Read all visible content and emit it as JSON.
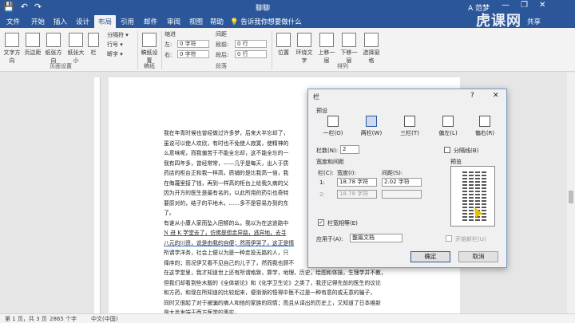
{
  "titlebar": {
    "doc_title": "聊聊",
    "user": "A 范梦",
    "minimize": "—",
    "restore": "❐",
    "close": "✕",
    "save_icon": "💾",
    "undo_icon": "↶",
    "redo_icon": "↷"
  },
  "tabs": [
    "文件",
    "开始",
    "插入",
    "设计",
    "布局",
    "引用",
    "邮件",
    "审阅",
    "视图",
    "帮助"
  ],
  "tell_me": "💡 告诉我你想要做什么",
  "share": "共享",
  "watermark": "虎课网",
  "ribbon": {
    "text_direction": "文字方向",
    "margins": "页边距",
    "orientation": "纸张方向",
    "size": "纸张大小",
    "columns": "栏",
    "breaks": "分隔符 ▾",
    "line_numbers": "行号 ▾",
    "hyphenation": "断字 ▾",
    "draft_paper": "稿纸设置",
    "indent_header": "缩进",
    "indent_left_label": "左:",
    "indent_left_value": "0 字符",
    "indent_right_label": "右:",
    "indent_right_value": "0 字符",
    "spacing_header": "间距",
    "spacing_before_label": "段前:",
    "spacing_before_value": "0 行",
    "spacing_after_label": "段后:",
    "spacing_after_value": "0 行",
    "position": "位置",
    "wrap_text": "环绕文字",
    "bring_forward": "上移一层",
    "send_backward": "下移一层",
    "selection_pane": "选择窗格",
    "page_setup_label": "页面设置",
    "draft_label": "稿纸",
    "paragraph_label": "段落",
    "arrange_label": "排列"
  },
  "document": {
    "lines": [
      "我在年青时候也曾经做过许多梦，后来大半忘却了，",
      "虽说可以使人欢欣，有时也不免使人寂寞，使精神的",
      "么意味呢，而我偏苦于不能全忘却，这不能全忘的一",
      "我有四年多，曾经常常，——几乎是每天，出入于质",
      "药店的柜台正和我一样高，质铺的是比我高一倍，我",
      "在侮蔑里接了钱，再到一样高的柜台上给我久病的父",
      "因为开方的医生是最有名的，以此所用的药引也奇特",
      "要原对的，结子的平地木，……多不是容易办到的东",
      "了。",
      "有谁从小康人家而坠入困顿的么，我以为在这途路中",
      "N 进 K 学堂去了，仿佛是想走异路，逃异地，去寻",
      "八元的川资，说是由我的自便；然而伊哭了，这正是情",
      "所谓学洋务，社会上便以为是一种走投无路的人，只",
      "择序的；而况伊又看不见自己的儿子了，然而我也顾不",
      "在这学堂里，我才知道世上还有所谓格致，算学，地理，历史，绘图和体操，生理学并不教，",
      "但我们却看到些木版的《全体新论》和《化学卫生论》之类了，我还记得先前的医生的议论",
      "和方药，和现在所知道的比较起来，便渐渐的悟得中医不过是一种有意的或无意的骗子，",
      "同时又很起了对于被骗的病人和他的家族的同情；而且从译出的历史上，又知道了日本维新",
      "是大半发端于西方医学的事实。"
    ]
  },
  "dialog": {
    "title": "栏",
    "help": "?",
    "close": "✕",
    "presets_label": "预设",
    "presets": [
      "一栏(O)",
      "两栏(W)",
      "三栏(T)",
      "偏左(L)",
      "偏右(R)"
    ],
    "num_columns_label": "栏数(N):",
    "num_columns_value": "2",
    "line_between_label": "分隔线(B)",
    "width_spacing_label": "宽度和间距",
    "preview_label": "预览",
    "col_header": "栏(C):",
    "width_header": "宽度(I):",
    "spacing_header": "间距(S):",
    "rows": [
      {
        "num": "1:",
        "width": "18.78 字符",
        "spacing": "2.02 字符"
      },
      {
        "num": "2:",
        "width": "18.78 字符",
        "spacing": ""
      }
    ],
    "equal_width_label": "栏宽相等(E)",
    "equal_width_checked": "✓",
    "apply_to_label": "应用于(A):",
    "apply_to_value": "整篇文档",
    "new_column_label": "开始新栏(U)",
    "ok": "确定",
    "cancel": "取消"
  },
  "status": {
    "page": "第 1 页，共 3 页",
    "words": "2865 个字",
    "lang": "中文(中国)"
  }
}
